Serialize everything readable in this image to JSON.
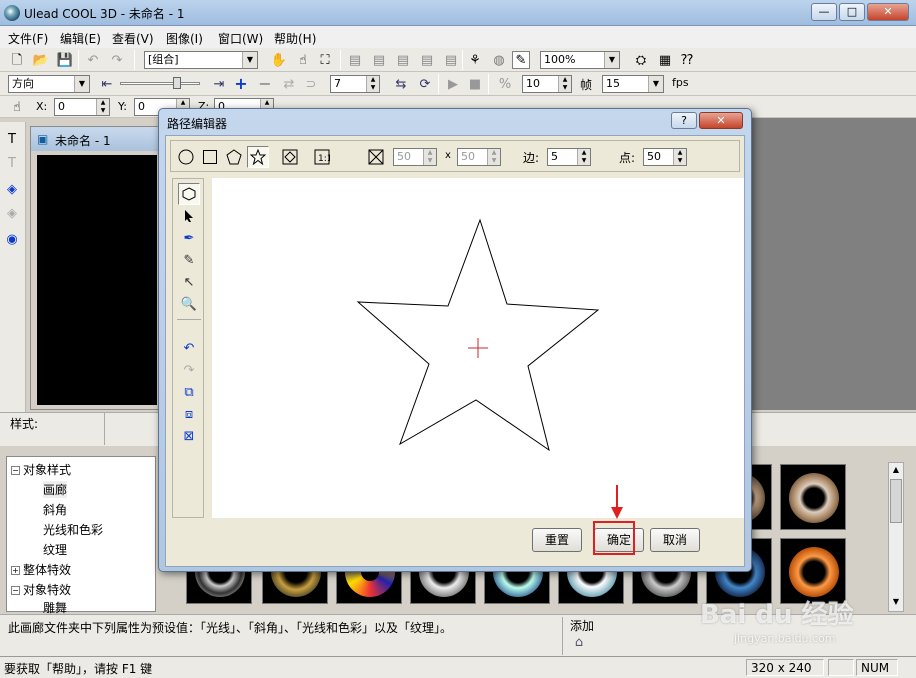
{
  "app": {
    "title": "Ulead COOL 3D - 未命名 - 1",
    "controls": {
      "minimize": "—",
      "maximize": "□",
      "close": "✕"
    }
  },
  "menubar": [
    "文件(F)",
    "编辑(E)",
    "查看(V)",
    "图像(I)",
    "窗口(W)",
    "帮助(H)"
  ],
  "toolbar1": {
    "object_combo": "[组合]",
    "zoom_combo": "100%"
  },
  "toolbar2": {
    "direction_combo": "方向",
    "frame_value": "7",
    "frames_total": "10",
    "frame_label": "帧",
    "fps_value": "15",
    "fps_label": "fps"
  },
  "toolbar3": {
    "x_label": "X:",
    "x_value": "0",
    "y_label": "Y:",
    "y_value": "0",
    "z_label": "Z:",
    "z_value": "0"
  },
  "document": {
    "title": "未命名 - 1"
  },
  "style_label": "样式:",
  "tree": [
    {
      "label": "对象样式",
      "expander": "⊟",
      "level": 0
    },
    {
      "label": "画廊",
      "level": 1
    },
    {
      "label": "斜角",
      "level": 1
    },
    {
      "label": "光线和色彩",
      "level": 1
    },
    {
      "label": "纹理",
      "level": 1
    },
    {
      "label": "整体特效",
      "expander": "⊞",
      "level": 0
    },
    {
      "label": "对象特效",
      "expander": "⊟",
      "level": 0
    },
    {
      "label": "雕舞",
      "level": 1
    }
  ],
  "description": "此画廊文件夹中下列属性为预设值：「光线」、「斜角」、「光线和色彩」以及「纹理」。",
  "add_label": "添加",
  "status": {
    "help_text": "要获取「帮助」，请按 F1 键",
    "dimensions": "320 x 240",
    "numlock": "NUM"
  },
  "dialog": {
    "title": "路径编辑器",
    "help": "?",
    "close": "✕",
    "width_value": "50",
    "x_sep": "x",
    "height_value": "50",
    "sides_label": "边:",
    "sides_value": "5",
    "points_label": "点:",
    "points_value": "50",
    "reset_button": "重置",
    "ok_button": "确定",
    "cancel_button": "取消"
  },
  "watermark": {
    "brand": "Bai du 经验",
    "url": "jingyan.baidu.com"
  },
  "colors": {
    "highlight": "#e02020",
    "title_gradient_top": "#bcd3ec",
    "canvas_bg": "#000000"
  }
}
